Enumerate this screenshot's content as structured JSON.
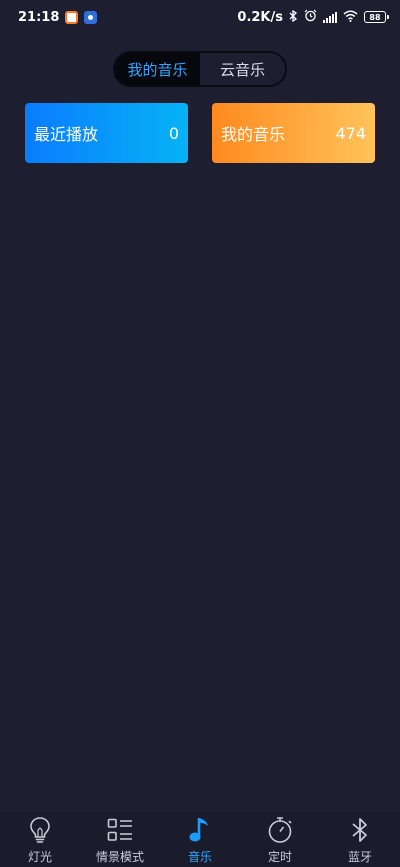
{
  "status_bar": {
    "time": "21:18",
    "network_speed": "0.2K/s",
    "battery": "88",
    "icons": [
      "bluetooth-icon",
      "alarm-icon",
      "signal-icon",
      "wifi-icon",
      "battery-icon"
    ]
  },
  "tabs": [
    {
      "label": "我的音乐",
      "active": true
    },
    {
      "label": "云音乐",
      "active": false
    }
  ],
  "cards": {
    "recent": {
      "label": "最近播放",
      "count": "0"
    },
    "mine": {
      "label": "我的音乐",
      "count": "474"
    }
  },
  "bottom_nav": [
    {
      "label": "灯光",
      "icon": "bulb-icon",
      "active": false
    },
    {
      "label": "情景模式",
      "icon": "scene-list-icon",
      "active": false
    },
    {
      "label": "音乐",
      "icon": "music-note-icon",
      "active": true
    },
    {
      "label": "定时",
      "icon": "timer-icon",
      "active": false
    },
    {
      "label": "蓝牙",
      "icon": "bluetooth-icon",
      "active": false
    }
  ],
  "colors": {
    "background": "#1d1f30",
    "accent": "#2fa6ff",
    "card_recent_start": "#0a7cff",
    "card_recent_end": "#06b3f5",
    "card_mine_start": "#ff8a1f",
    "card_mine_end": "#ffc35a"
  }
}
